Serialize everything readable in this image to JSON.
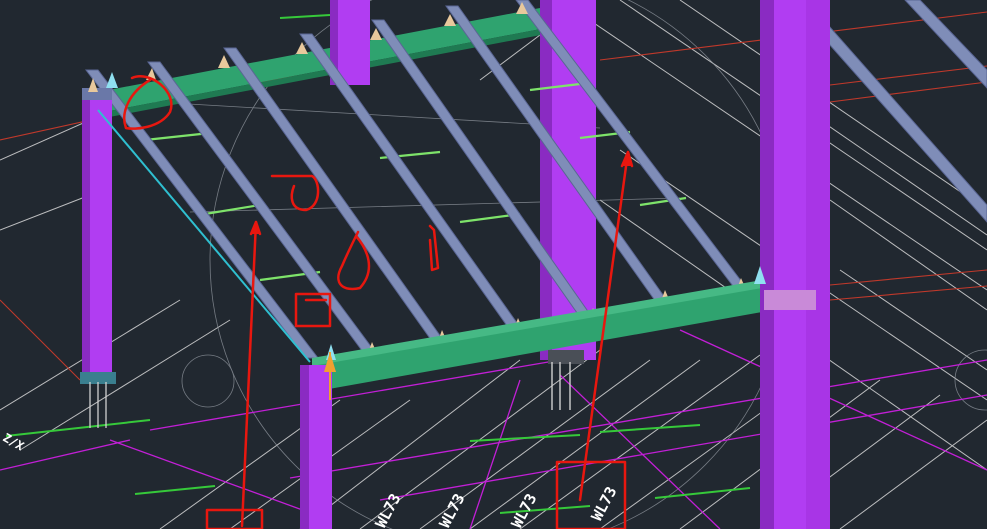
{
  "viewport": {
    "background": "#212830",
    "grid_line_color": "#d8d8d8",
    "axis_line_color": "#c0392b",
    "magenta_line_color": "#c21fd6",
    "column_color": "#b13df2",
    "beam_color": "#2fa36f",
    "purlin_color": "#7f8db8",
    "markup_color": "#e8170f",
    "labels": {
      "bay_1": "WL73",
      "bay_2": "WL73",
      "bay_3": "WL73",
      "bay_4": "WL73",
      "axis": "Z/X"
    }
  }
}
